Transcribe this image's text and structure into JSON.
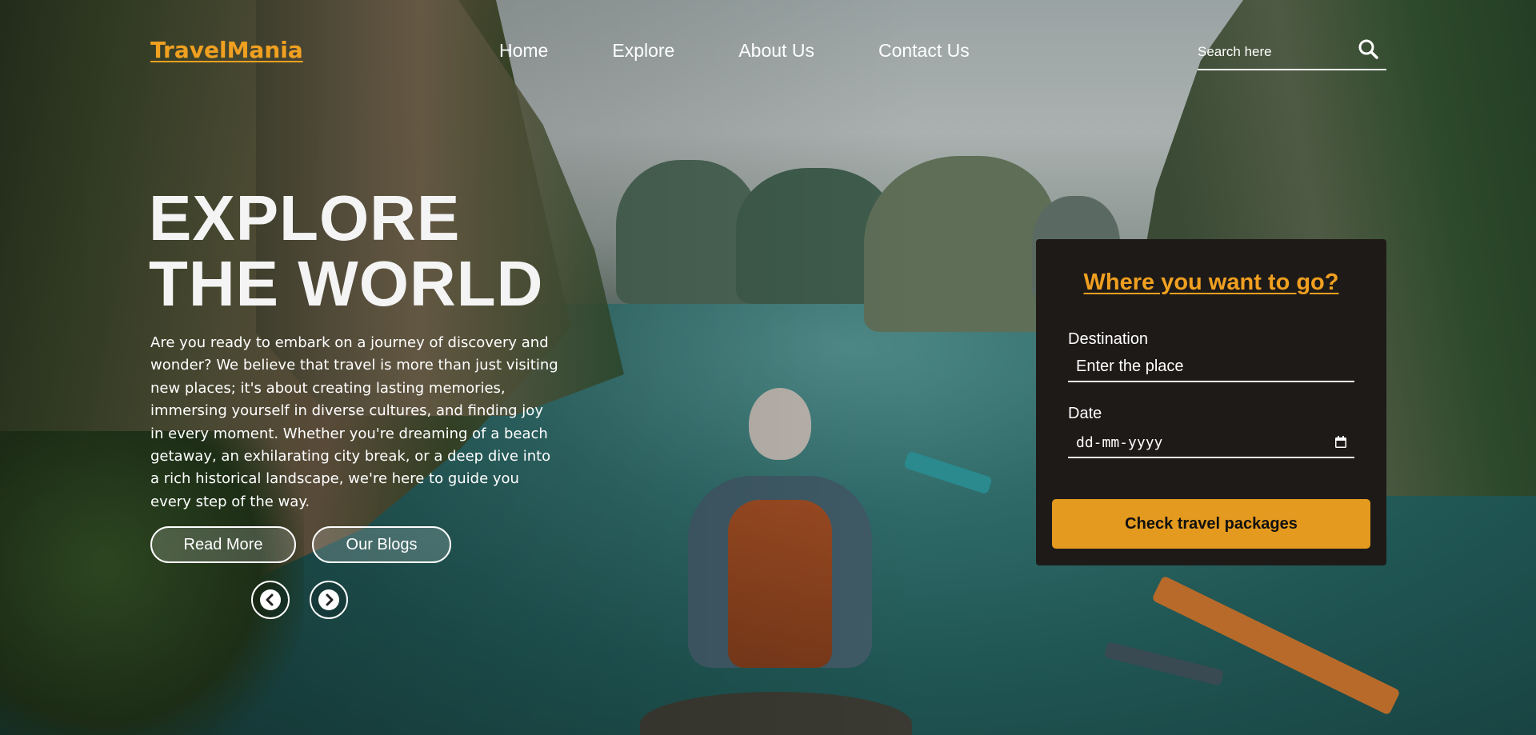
{
  "header": {
    "logo": "TravelMania",
    "nav": [
      "Home",
      "Explore",
      "About Us",
      "Contact Us"
    ],
    "search_placeholder": "Search here"
  },
  "hero": {
    "title_line1": "EXPLORE",
    "title_line2": "THE WORLD",
    "description": "Are you ready to embark on a journey of discovery and wonder? We believe that travel is more than just visiting new places; it's about creating lasting memories, immersing yourself in diverse cultures, and finding joy in every moment. Whether you're dreaming of a beach getaway, an exhilarating city break, or a deep dive into a rich historical landscape, we're here to guide you every step of the way.",
    "read_more": "Read More",
    "our_blogs": "Our Blogs"
  },
  "booking": {
    "title": "Where you want to go?",
    "destination_label": "Destination",
    "destination_placeholder": "Enter the place",
    "date_label": "Date",
    "date_placeholder": "dd-mm-yyyy",
    "submit": "Check travel packages"
  },
  "colors": {
    "accent": "#f0a020",
    "button": "#e49a1e",
    "card_bg": "#1e1a18"
  },
  "icons": {
    "search": "search-icon",
    "prev": "chevron-left-icon",
    "next": "chevron-right-icon",
    "calendar": "calendar-icon"
  }
}
